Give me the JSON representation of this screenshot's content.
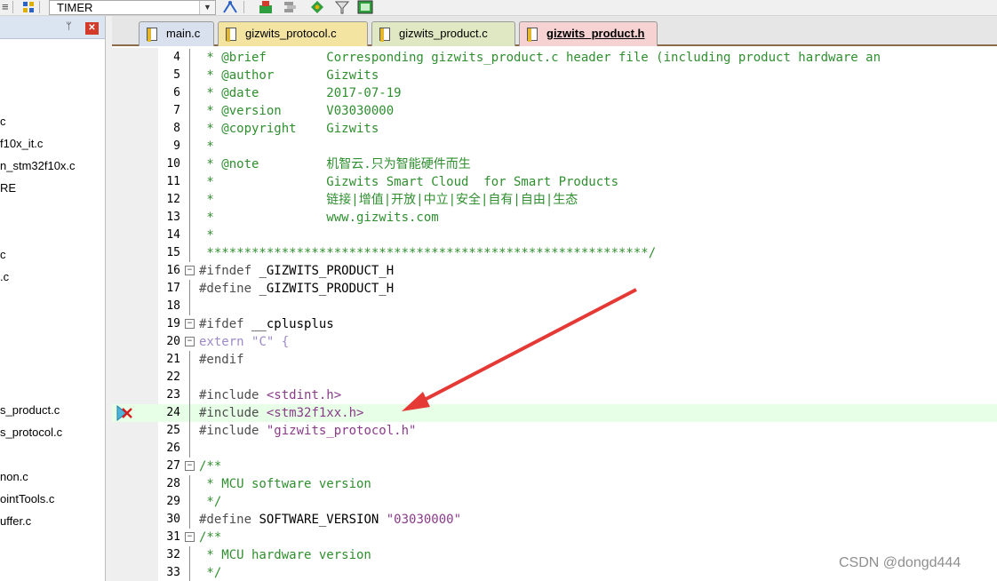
{
  "toolbar": {
    "target_name": "TIMER"
  },
  "project_tree": {
    "items": [
      {
        "label": "c",
        "row": 0
      },
      {
        "label": "f10x_it.c",
        "row": 1
      },
      {
        "label": "n_stm32f10x.c",
        "row": 2
      },
      {
        "label": "RE",
        "row": 3
      },
      {
        "label": "c",
        "row": 6
      },
      {
        "label": ".c",
        "row": 7
      },
      {
        "label": "s_product.c",
        "row": 13
      },
      {
        "label": "s_protocol.c",
        "row": 14
      },
      {
        "label": "non.c",
        "row": 16
      },
      {
        "label": "ointTools.c",
        "row": 17
      },
      {
        "label": "uffer.c",
        "row": 18
      }
    ]
  },
  "tabs": [
    {
      "label": "main.c",
      "active": false,
      "color": "#d9e1ef"
    },
    {
      "label": "gizwits_protocol.c",
      "active": false,
      "color": "#f3e4a2"
    },
    {
      "label": "gizwits_product.c",
      "active": false,
      "color": "#dfe8c2"
    },
    {
      "label": "gizwits_product.h",
      "active": true,
      "color": "#f6d2d2"
    }
  ],
  "editor": {
    "highlight_line": 24,
    "lines": [
      {
        "n": "4",
        "code": " * @brief        Corresponding gizwits_product.c header file (including product hardware an"
      },
      {
        "n": "5",
        "code": " * @author       Gizwits"
      },
      {
        "n": "6",
        "code": " * @date         2017-07-19"
      },
      {
        "n": "7",
        "code": " * @version      V03030000"
      },
      {
        "n": "8",
        "code": " * @copyright    Gizwits"
      },
      {
        "n": "9",
        "code": " *"
      },
      {
        "n": "10",
        "code": " * @note         机智云.只为智能硬件而生"
      },
      {
        "n": "11",
        "code": " *               Gizwits Smart Cloud  for Smart Products"
      },
      {
        "n": "12",
        "code": " *               链接|增值|开放|中立|安全|自有|自由|生态"
      },
      {
        "n": "13",
        "code": " *               www.gizwits.com"
      },
      {
        "n": "14",
        "code": " *"
      },
      {
        "n": "15",
        "code": " ***********************************************************/"
      },
      {
        "n": "16",
        "pp": "#ifndef",
        "rest": " _GIZWITS_PRODUCT_H"
      },
      {
        "n": "17",
        "pp": "#define",
        "rest": " _GIZWITS_PRODUCT_H"
      },
      {
        "n": "18",
        "code": ""
      },
      {
        "n": "19",
        "pp": "#ifdef",
        "rest": " __cplusplus"
      },
      {
        "n": "20",
        "kw": "extern",
        "str": "\"C\"",
        "tail": " {"
      },
      {
        "n": "21",
        "pp": "#endif",
        "rest": ""
      },
      {
        "n": "22",
        "code": ""
      },
      {
        "n": "23",
        "pp": "#include",
        "str": "<stdint.h>"
      },
      {
        "n": "24",
        "pp": "#include",
        "str": "<stm32f1xx.h>"
      },
      {
        "n": "25",
        "pp": "#include",
        "str": "\"gizwits_protocol.h\""
      },
      {
        "n": "26",
        "code": ""
      },
      {
        "n": "27",
        "code": "/**"
      },
      {
        "n": "28",
        "code": " * MCU software version"
      },
      {
        "n": "29",
        "code": " */"
      },
      {
        "n": "30",
        "pp": "#define",
        "rest": " SOFTWARE_VERSION ",
        "str": "\"03030000\""
      },
      {
        "n": "31",
        "code": "/**"
      },
      {
        "n": "32",
        "code": " * MCU hardware version"
      },
      {
        "n": "33",
        "code": " */"
      }
    ]
  },
  "watermark": "CSDN @dongd444",
  "colors": {
    "comment": "#2f8f2f",
    "string": "#8a3b8a",
    "highlight_line": "#e6ffe6",
    "annotation_arrow": "#e53935"
  }
}
